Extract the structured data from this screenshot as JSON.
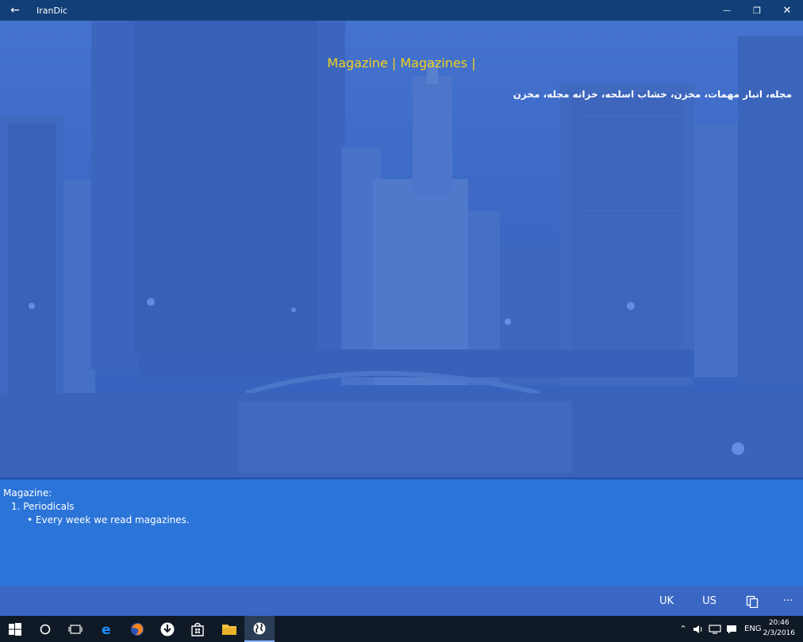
{
  "window": {
    "title": "IranDic",
    "back_glyph": "←",
    "minimize_glyph": "—",
    "maximize_glyph": "❐",
    "close_glyph": "✕"
  },
  "entry": {
    "word_title": "Magazine  | Magazines |",
    "persian_meaning": "مجله، انبار مهمات، مخزن، خشاب اسلحه، خزانه مجله، مخزن"
  },
  "definition": {
    "heading": "Magazine:",
    "sense": "1. Periodicals",
    "example": "• Every week we read magazines."
  },
  "command_bar": {
    "uk_label": "UK",
    "us_label": "US",
    "more_label": "···"
  },
  "taskbar": {
    "language": "ENG",
    "time": "20:46",
    "date": "2/3/2016"
  },
  "colors": {
    "title_bar": "#123f77",
    "background": "#3a67c4",
    "definition_panel": "#2b74d8",
    "word_title": "#f2d21a",
    "taskbar": "#101a26"
  }
}
